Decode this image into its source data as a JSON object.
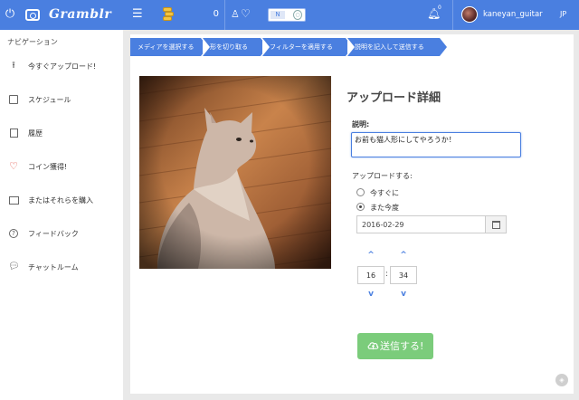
{
  "header": {
    "app_name": "Gramblr",
    "coin_count": "0",
    "toggle_label": "N",
    "notification_count": "0",
    "username": "kaneyan_guitar",
    "language": "JP"
  },
  "sidebar": {
    "title": "ナビゲーション",
    "items": [
      {
        "label": "今すぐアップロード!",
        "icon": "upload-icon"
      },
      {
        "label": "スケジュール",
        "icon": "calendar-icon"
      },
      {
        "label": "履歴",
        "icon": "history-icon"
      },
      {
        "label": "コイン獲得!",
        "icon": "heart-icon"
      },
      {
        "label": "またはそれらを購入",
        "icon": "cart-icon"
      },
      {
        "label": "フィードバック",
        "icon": "question-icon"
      },
      {
        "label": "チャットルーム",
        "icon": "chat-icon"
      }
    ]
  },
  "steps": [
    "メディアを選択する",
    "形を切り取る",
    "フィルターを適用する",
    "説明を記入して送信する"
  ],
  "form": {
    "title": "アップロード詳細",
    "description_label": "説明:",
    "description_value": "お前も猫人形にしてやろうか！",
    "upload_label": "アップロードする:",
    "option_now": "今すぐに",
    "option_later": "また今度",
    "date_value": "2016-02-29",
    "hour": "16",
    "minute": "34",
    "send_label": "送信する!"
  },
  "colors": {
    "accent": "#4a7fe0",
    "send_button": "#7bcc7b",
    "heart": "#e0463a"
  }
}
